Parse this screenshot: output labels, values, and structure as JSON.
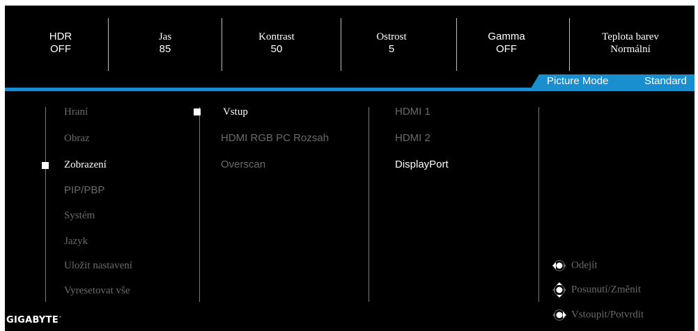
{
  "status": {
    "hdr": {
      "label": "HDR",
      "value": "OFF"
    },
    "jas": {
      "label": "Jas",
      "value": "85"
    },
    "kontrast": {
      "label": "Kontrast",
      "value": "50"
    },
    "ostrost": {
      "label": "Ostrost",
      "value": "5"
    },
    "gamma": {
      "label": "Gamma",
      "value": "OFF"
    },
    "teplota": {
      "label": "Teplota barev",
      "value": "Normální"
    }
  },
  "picture_mode": {
    "label": "Picture Mode",
    "value": "Standard"
  },
  "main_menu": {
    "items": [
      "Hraní",
      "Obraz",
      "Zobrazení",
      "PIP/PBP",
      "Systém",
      "Jazyk",
      "Uložit nastavení",
      "Vyresetovat vše"
    ],
    "selected": "Zobrazení"
  },
  "sub_menu": {
    "items": [
      "Vstup",
      "HDMI RGB PC Rozsah",
      "Overscan"
    ],
    "selected": "Vstup"
  },
  "options": {
    "items": [
      "HDMI 1",
      "HDMI 2",
      "DisplayPort"
    ],
    "selected": "DisplayPort"
  },
  "hints": {
    "exit": "Odejít",
    "move": "Posunutí/Změnit",
    "enter": "Vstoupit/Potvrdit"
  },
  "brand": "GIGABYTE",
  "colors": {
    "accent": "#1a8fd0",
    "background": "#000000",
    "inactive_text": "#6a6a6a"
  }
}
